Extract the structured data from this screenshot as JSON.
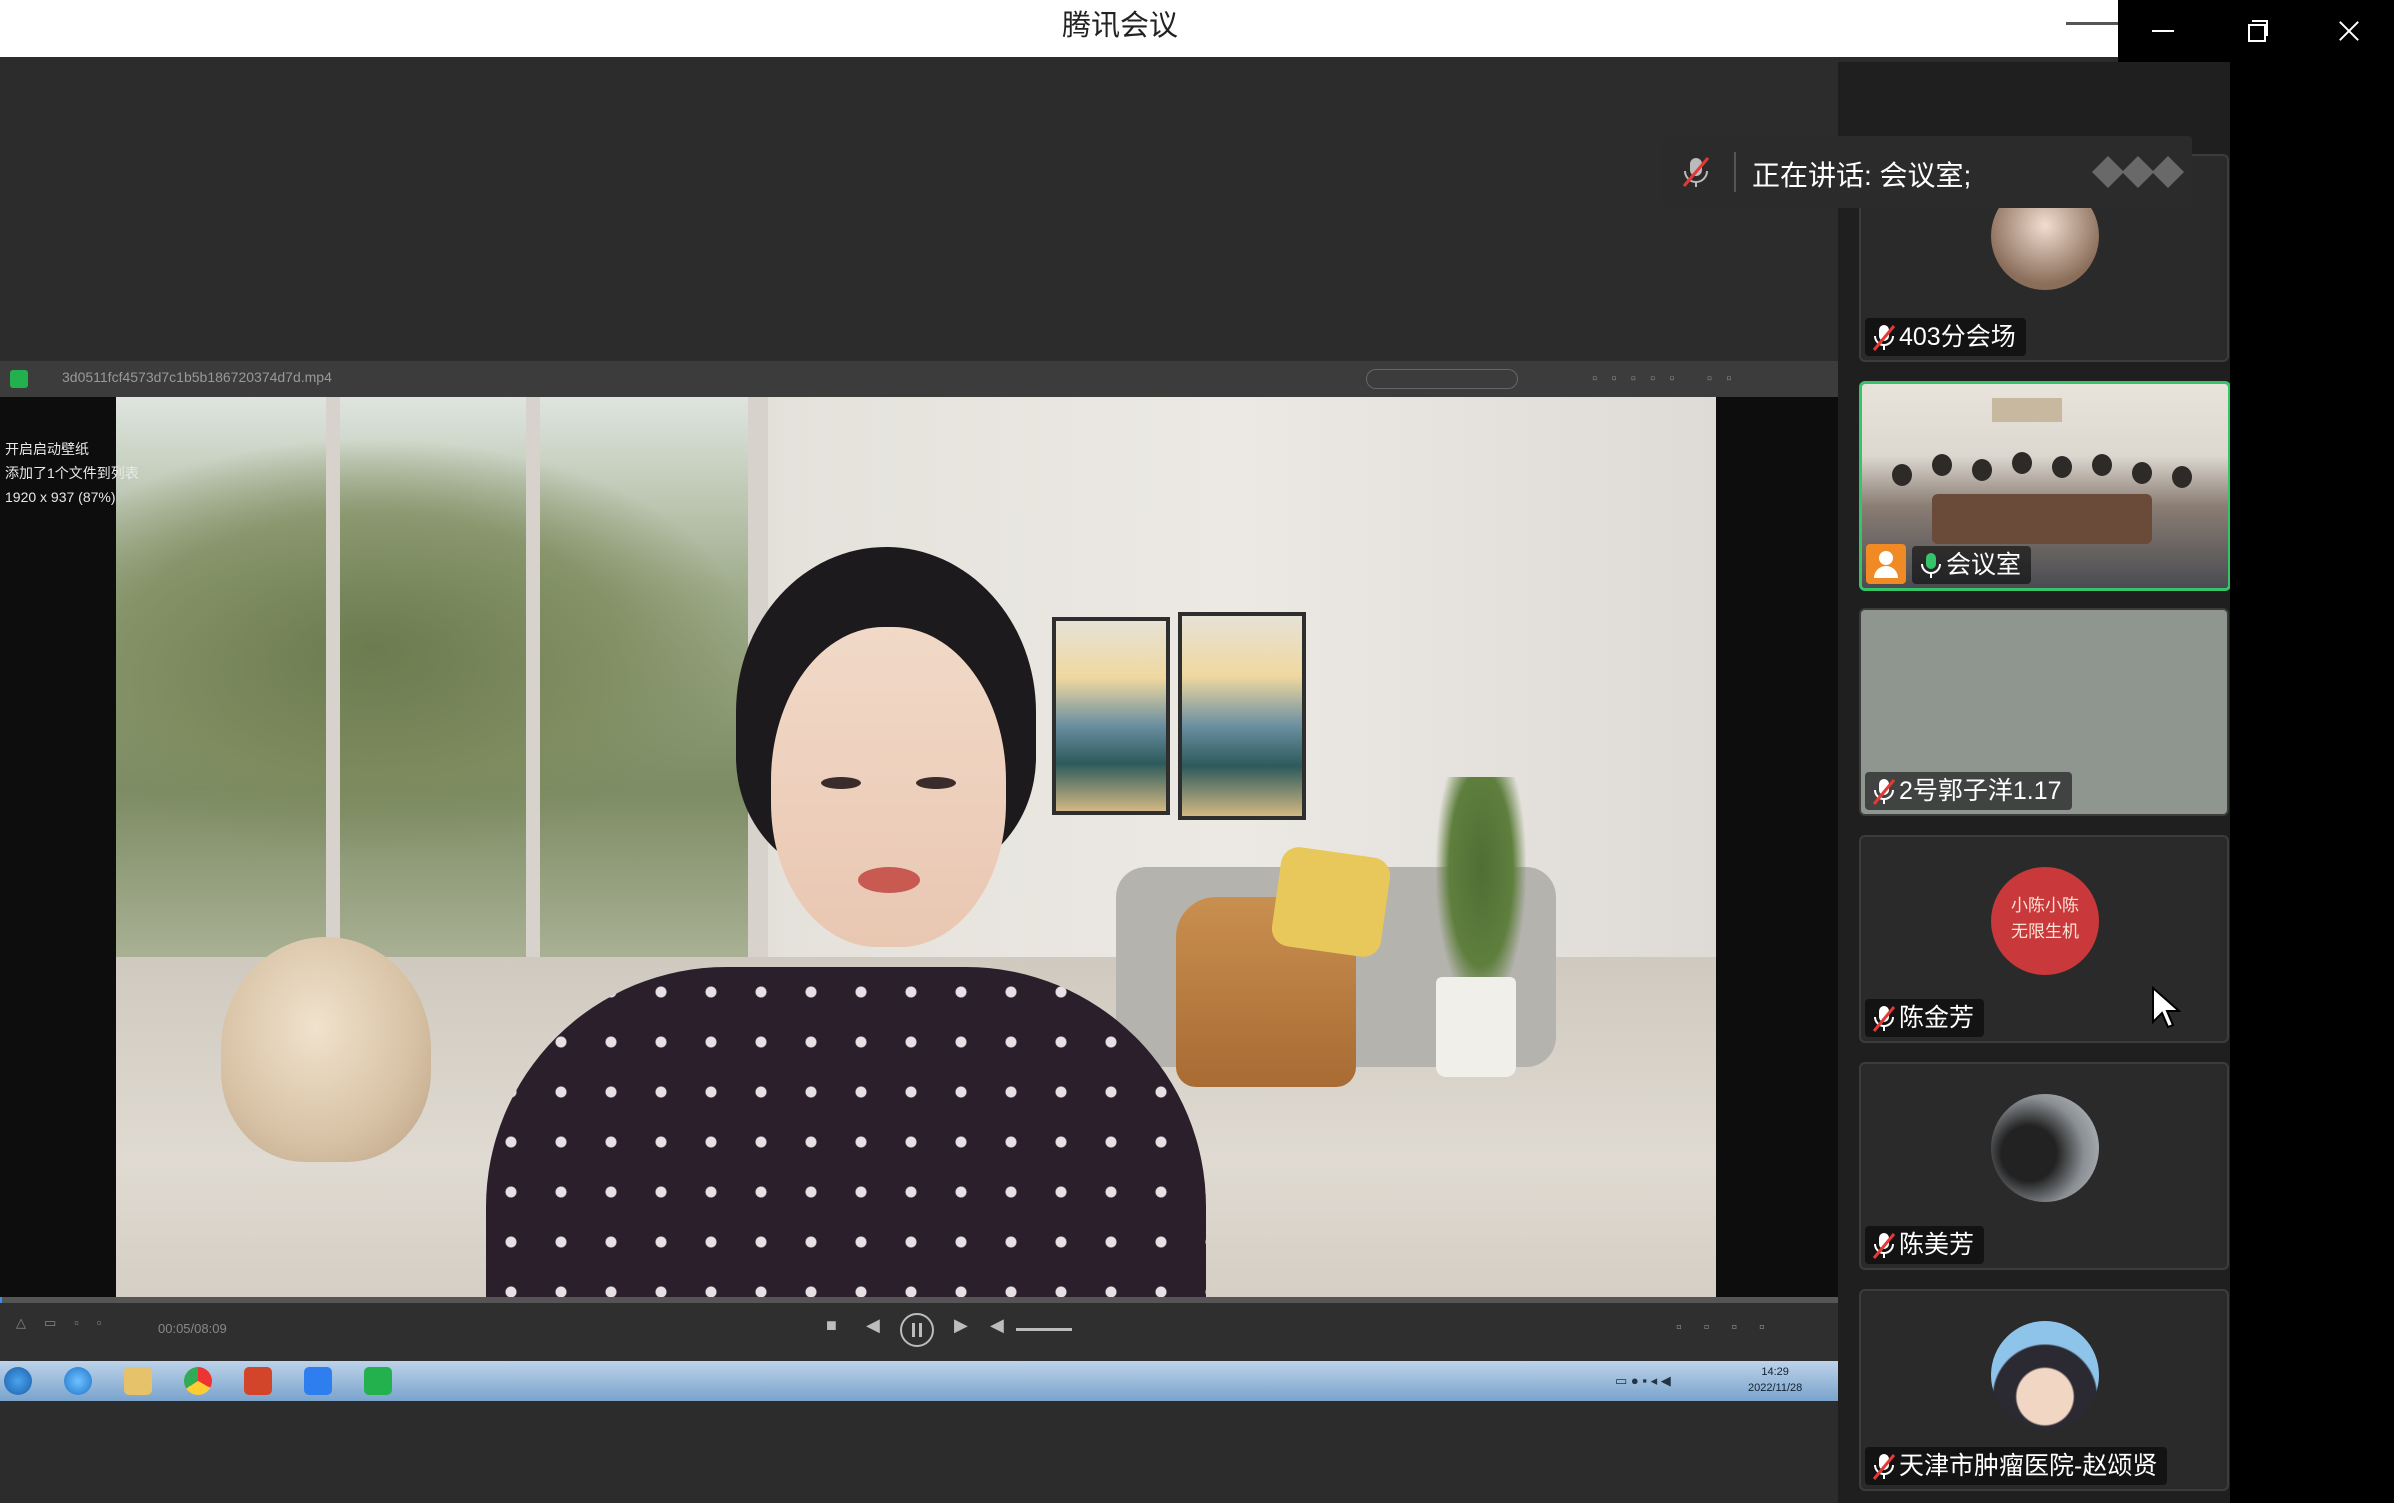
{
  "window": {
    "title": "腾讯会议"
  },
  "speaking": {
    "text": "正在讲话: 会议室;"
  },
  "player": {
    "filename": "3d0511fcf4573d7c1b5b186720374d7d.mp4",
    "overlay_line1": "开启启动壁纸",
    "overlay_line2": "添加了1个文件到列表",
    "overlay_line3": "1920 x 937 (87%)",
    "time": "00:05/08:09"
  },
  "taskbar": {
    "clock_time": "14:29",
    "clock_date": "2022/11/28"
  },
  "participants": [
    {
      "name": "403分会场",
      "mic": "muted"
    },
    {
      "name": "会议室",
      "mic": "active"
    },
    {
      "name": "2号郭子洋1.17",
      "mic": "muted"
    },
    {
      "name": "陈金芳",
      "mic": "muted",
      "avatar_text_1": "小陈小陈",
      "avatar_text_2": "无限生机"
    },
    {
      "name": "陈美芳",
      "mic": "muted"
    },
    {
      "name": "天津市肿瘤医院-赵颂贤",
      "mic": "muted"
    }
  ],
  "colors": {
    "active_border": "#35c46a",
    "muted_icon": "#e53935",
    "accent": "#f08a24"
  }
}
